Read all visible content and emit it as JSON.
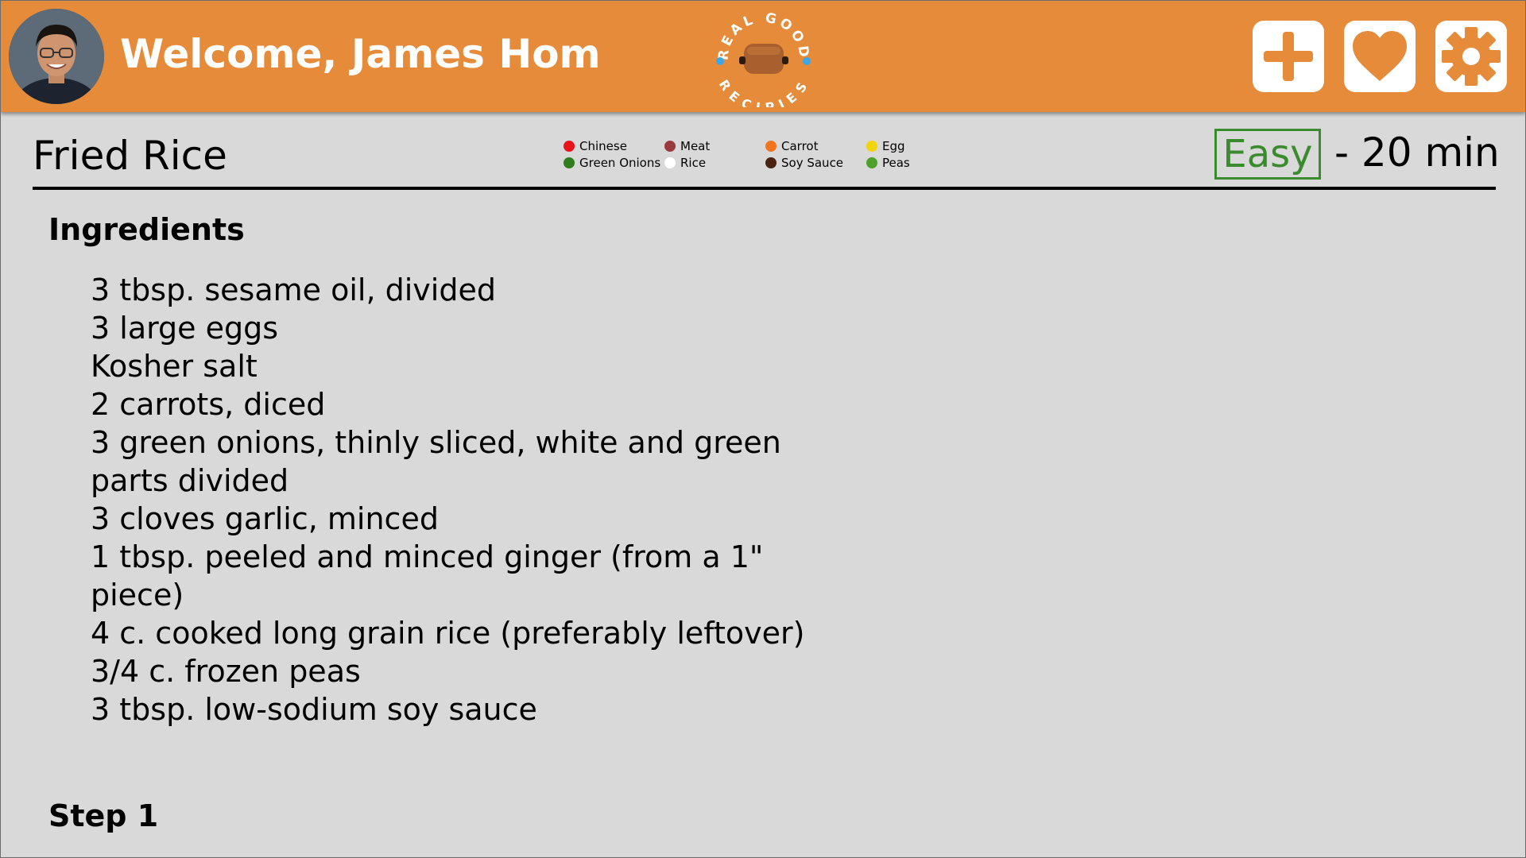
{
  "header": {
    "welcome": "Welcome, James Hom",
    "logo": {
      "top_text": "REAL GOOD",
      "bottom_text": "RECIPIES"
    },
    "buttons": {
      "add": "add-icon",
      "favorites": "heart-icon",
      "settings": "gear-icon"
    }
  },
  "recipe": {
    "title": "Fried Rice",
    "difficulty": "Easy",
    "time": "- 20 min",
    "tags": [
      {
        "label": "Chinese",
        "color": "#e8141b"
      },
      {
        "label": "Green Onions",
        "color": "#2f7d1b"
      },
      {
        "label": "Meat",
        "color": "#9b3a3e"
      },
      {
        "label": "Rice",
        "color": "#ffffff"
      },
      {
        "label": "Carrot",
        "color": "#f2741d"
      },
      {
        "label": "Soy Sauce",
        "color": "#4a2410"
      },
      {
        "label": "Egg",
        "color": "#f5d40c"
      },
      {
        "label": "Peas",
        "color": "#4ea22a"
      }
    ],
    "ingredients_heading": "Ingredients",
    "ingredients": [
      "3 tbsp. sesame oil, divided",
      "3 large eggs",
      "Kosher salt",
      "2 carrots, diced",
      "3 green onions, thinly sliced, white and green parts divided",
      "3 cloves garlic, minced",
      "1 tbsp. peeled and minced ginger (from a 1\" piece)",
      "4 c. cooked long grain rice (preferably leftover)",
      "3/4 c. frozen peas",
      "3 tbsp. low-sodium soy sauce"
    ],
    "step_heading": "Step 1"
  },
  "colors": {
    "header": "#e68b3a",
    "background": "#d9d9d9",
    "difficulty": "#3a8a2e",
    "logo_dots": "#3aa8e8"
  }
}
